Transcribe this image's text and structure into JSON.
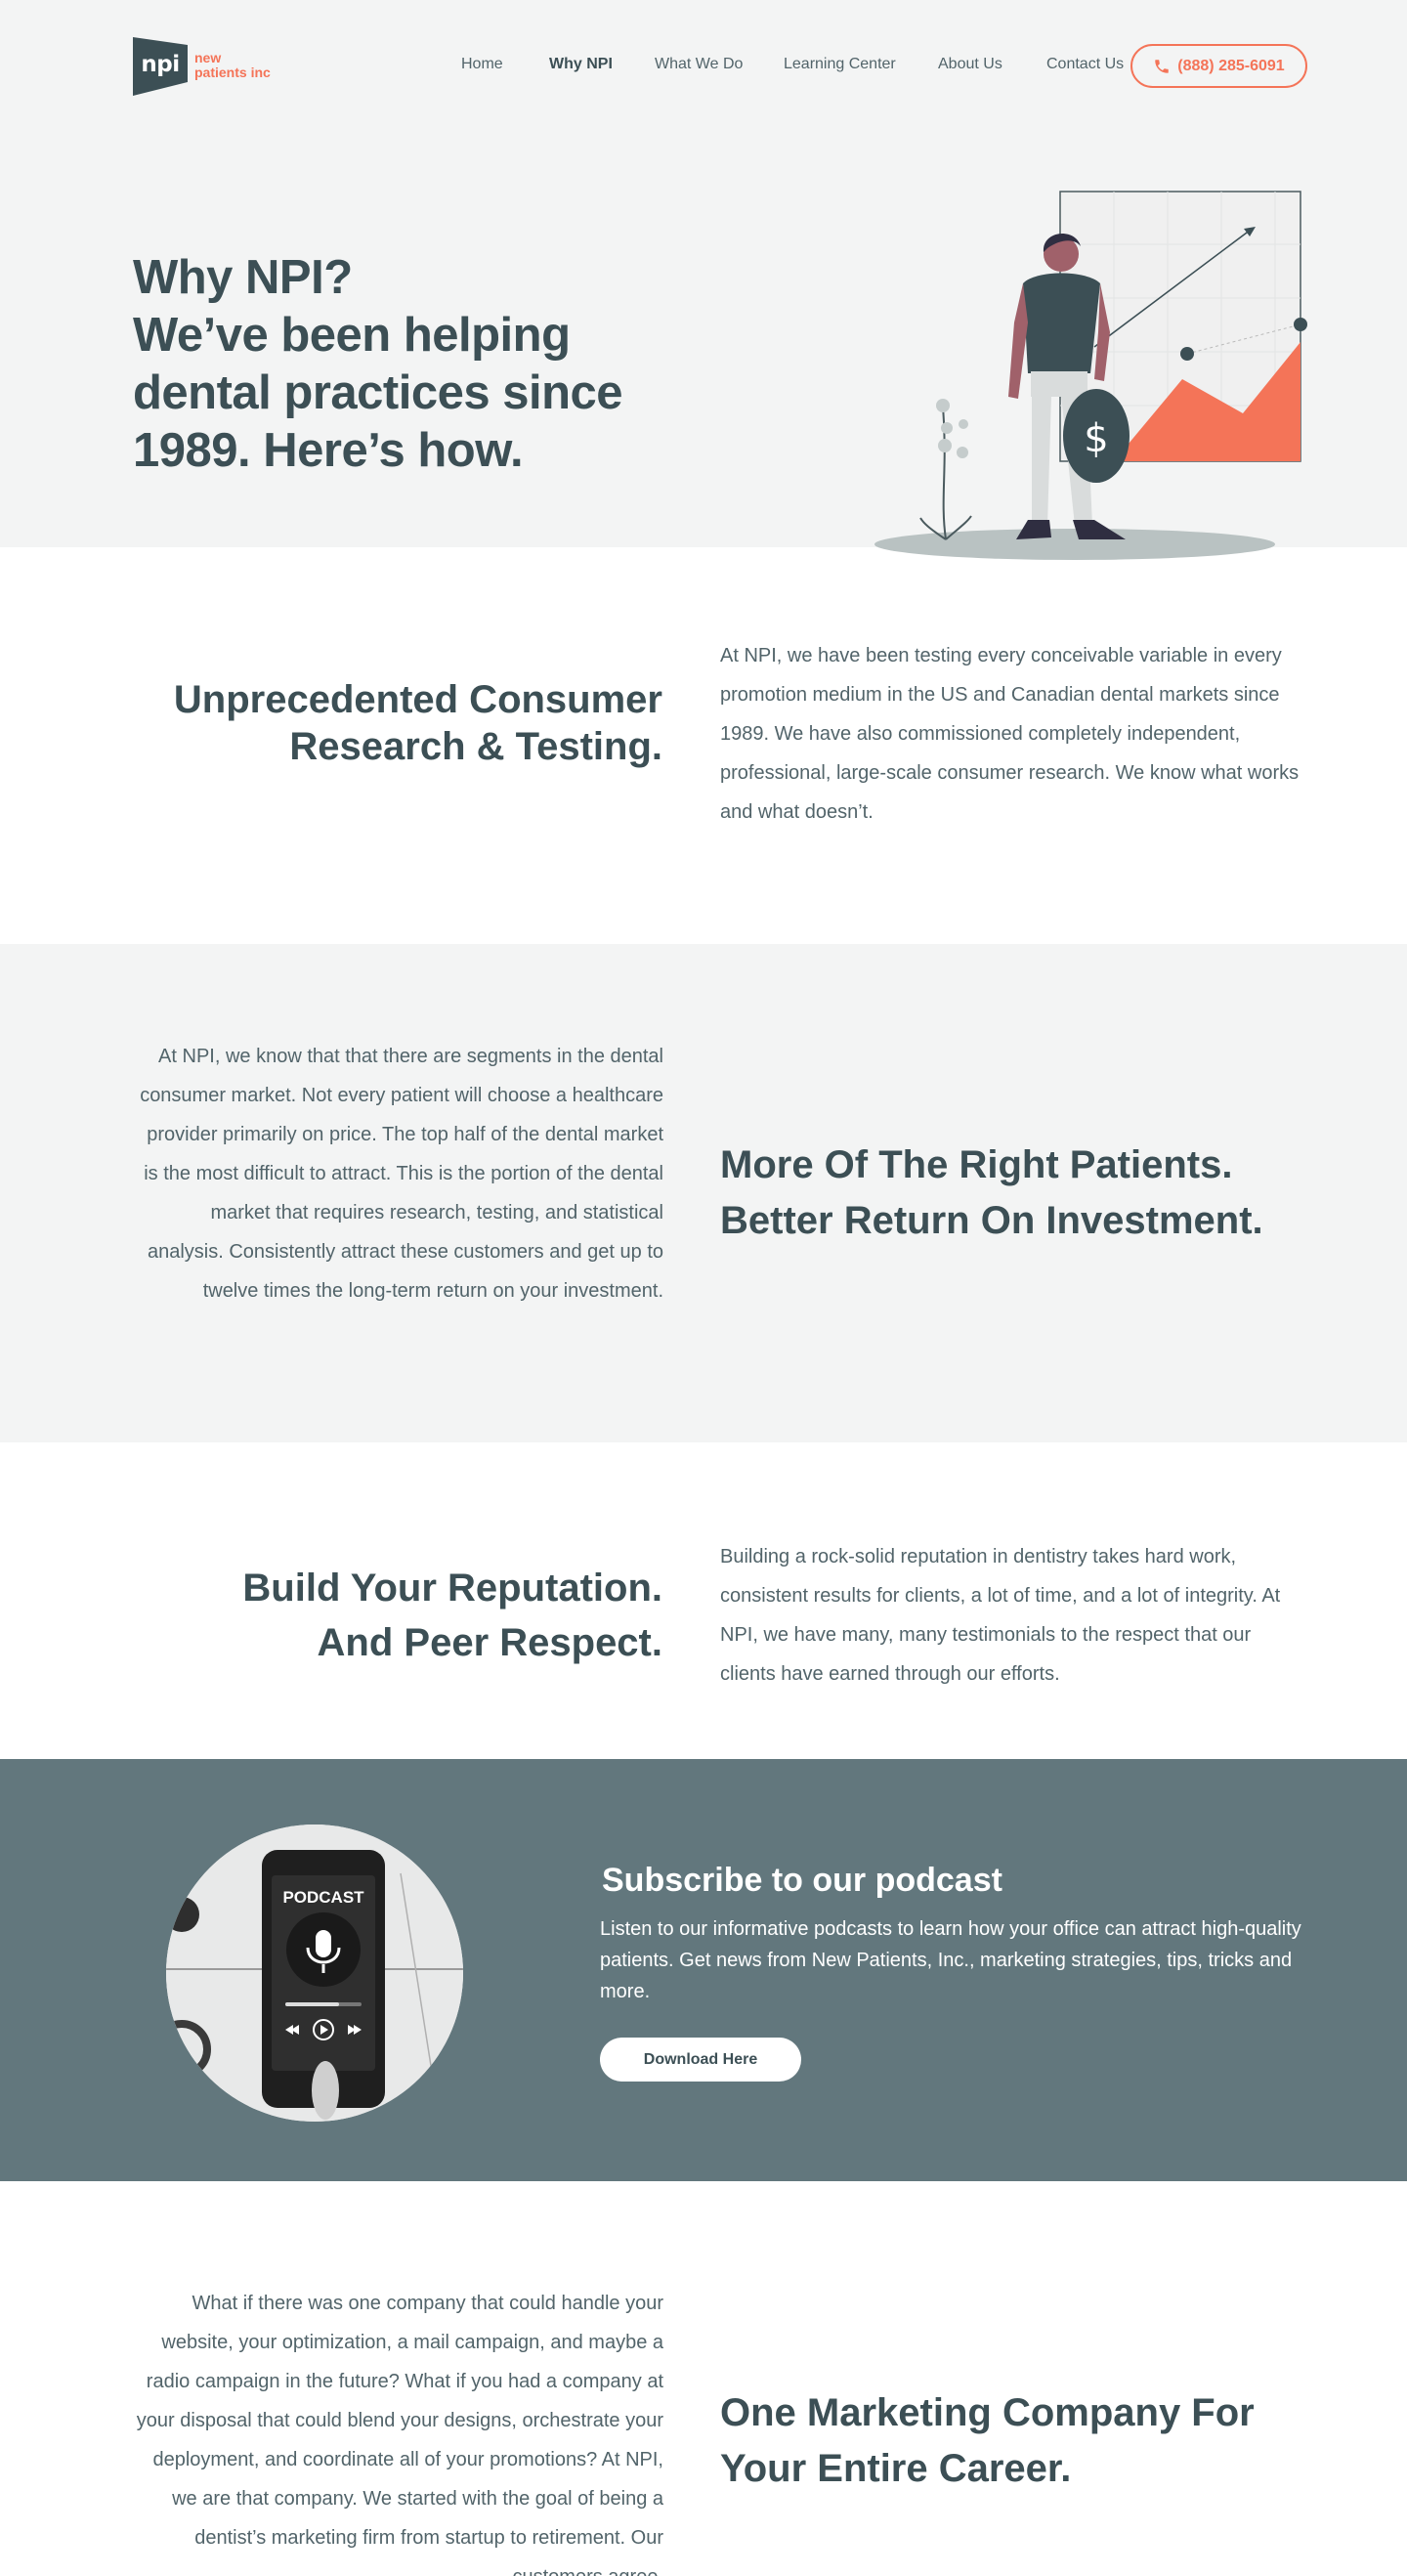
{
  "brand": {
    "logo_mark": "npi",
    "logo_line1": "new",
    "logo_line2": "patients inc",
    "accent_color": "#f47458",
    "dark_color": "#3c4f55",
    "slate_color": "#62777d"
  },
  "nav": {
    "items": [
      "Home",
      "Why NPI",
      "What We Do",
      "Learning Center",
      "About Us",
      "Contact Us"
    ],
    "active": "Why NPI",
    "phone": "(888) 285-6091",
    "phone_icon": "phone-icon"
  },
  "hero": {
    "title_line1": "Why NPI?",
    "title_line2": "We’ve been helping",
    "title_line3": "dental practices since",
    "title_line4": "1989. Here’s how.",
    "illustration_coin_symbol": "$"
  },
  "sections": {
    "research": {
      "heading_line1": "Unprecedented Consumer",
      "heading_line2": "Research & Testing.",
      "body": "At NPI, we have been testing every conceivable variable in every promotion medium in the US and Canadian dental markets since 1989. We have also commissioned completely independent, professional, large-scale consumer research. We know what works and what doesn’t."
    },
    "patients": {
      "heading_line1": "More Of The Right Patients.",
      "heading_line2": "Better Return On Investment.",
      "body": "At NPI, we know that that there are segments in the dental consumer market. Not every patient will choose a healthcare provider primarily on price. The top half of the dental market is the most difficult to attract. This is the portion of the dental market that requires research, testing, and statistical analysis. Consistently attract these customers and get up to twelve times the long-term return on your investment."
    },
    "reputation": {
      "heading_line1": "Build Your Reputation.",
      "heading_line2": "And Peer Respect.",
      "body": "Building a rock-solid reputation in dentistry takes hard work, consistent results for clients, a lot of time, and a lot of integrity. At NPI, we have many, many testimonials to the respect that our clients have earned through our efforts."
    },
    "podcast": {
      "phone_label": "PODCAST",
      "title": "Subscribe to our podcast",
      "body": "Listen to our informative podcasts to learn how your office can attract high-quality patients. Get news from New Patients, Inc., marketing strategies, tips, tricks and more.",
      "button": "Download Here"
    },
    "career": {
      "heading_line1": "One Marketing Company For",
      "heading_line2": "Your Entire Career.",
      "body": "What if there was one company that could handle your website, your optimization, a mail campaign, and maybe a radio campaign in the future? What if you had a company at your disposal that could blend your designs, orchestrate your deployment, and coordinate all of your promotions? At NPI, we are that company. We started with the goal of being a dentist’s marketing firm from startup to retirement. Our customers agree."
    }
  }
}
